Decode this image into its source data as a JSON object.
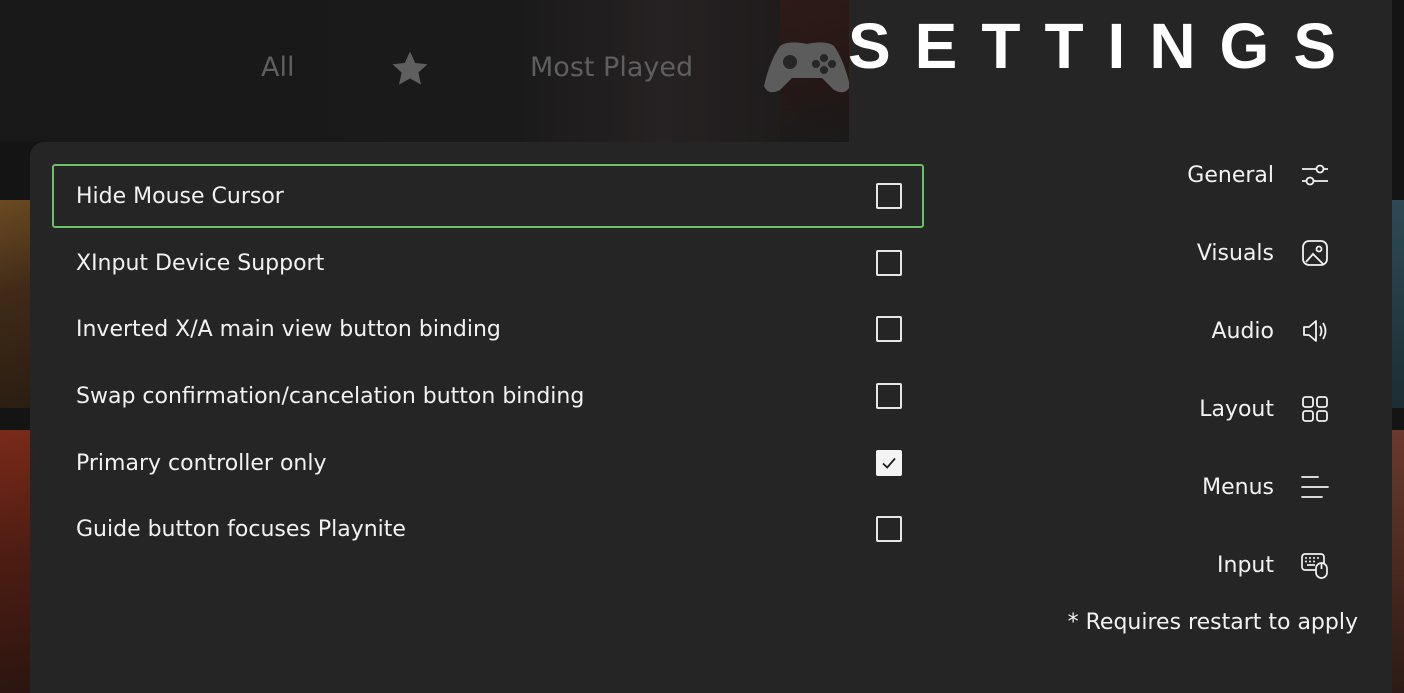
{
  "top_nav": {
    "all_label": "All",
    "favorites_icon": "star-icon",
    "most_played_label": "Most Played",
    "controller_icon": "gamepad-icon"
  },
  "settings": {
    "title": "SETTINGS",
    "menu": [
      {
        "label": "General",
        "icon": "sliders-icon"
      },
      {
        "label": "Visuals",
        "icon": "image-icon"
      },
      {
        "label": "Audio",
        "icon": "speaker-icon"
      },
      {
        "label": "Layout",
        "icon": "grid-icon"
      },
      {
        "label": "Menus",
        "icon": "lines-icon"
      },
      {
        "label": "Input",
        "icon": "keyboard-mouse-icon"
      }
    ],
    "footnote": "* Requires restart to apply"
  },
  "input_options": [
    {
      "label": "Hide Mouse Cursor",
      "checked": false,
      "focused": true
    },
    {
      "label": "XInput Device Support",
      "checked": false,
      "focused": false
    },
    {
      "label": "Inverted X/A main view button binding",
      "checked": false,
      "focused": false
    },
    {
      "label": "Swap confirmation/cancelation button binding",
      "checked": false,
      "focused": false
    },
    {
      "label": "Primary controller only",
      "checked": true,
      "focused": false
    },
    {
      "label": "Guide button focuses Playnite",
      "checked": false,
      "focused": false
    }
  ],
  "colors": {
    "panel_bg": "#252525",
    "focus_border": "#6abf69",
    "text": "#f2f2f2"
  }
}
